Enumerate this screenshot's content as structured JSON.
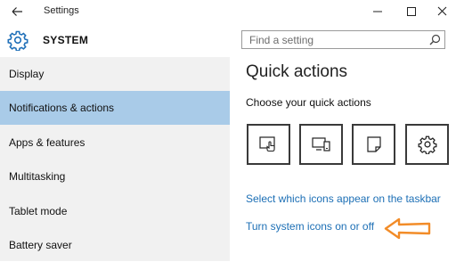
{
  "window": {
    "title": "Settings",
    "controls": [
      "minimize-icon",
      "maximize-icon",
      "close-icon"
    ]
  },
  "header": {
    "icon": "gear-icon",
    "title": "SYSTEM",
    "search": {
      "placeholder": "Find a setting",
      "icon": "search-icon"
    }
  },
  "sidebar": {
    "items": [
      {
        "label": "Display",
        "selected": false
      },
      {
        "label": "Notifications & actions",
        "selected": true
      },
      {
        "label": "Apps & features",
        "selected": false
      },
      {
        "label": "Multitasking",
        "selected": false
      },
      {
        "label": "Tablet mode",
        "selected": false
      },
      {
        "label": "Battery saver",
        "selected": false
      }
    ],
    "selected_color": "#a9cbe8"
  },
  "main": {
    "title": "Quick actions",
    "subtitle": "Choose your quick actions",
    "quick_actions": [
      {
        "icon": "tablet-mode-icon"
      },
      {
        "icon": "connect-display-icon"
      },
      {
        "icon": "note-icon"
      },
      {
        "icon": "settings-gear-icon"
      }
    ],
    "links": [
      "Select which icons appear on the taskbar",
      "Turn system icons on or off"
    ],
    "link_color": "#1c6fb5",
    "annotation": {
      "icon": "orange-arrow-icon",
      "color": "#f28c28"
    }
  }
}
